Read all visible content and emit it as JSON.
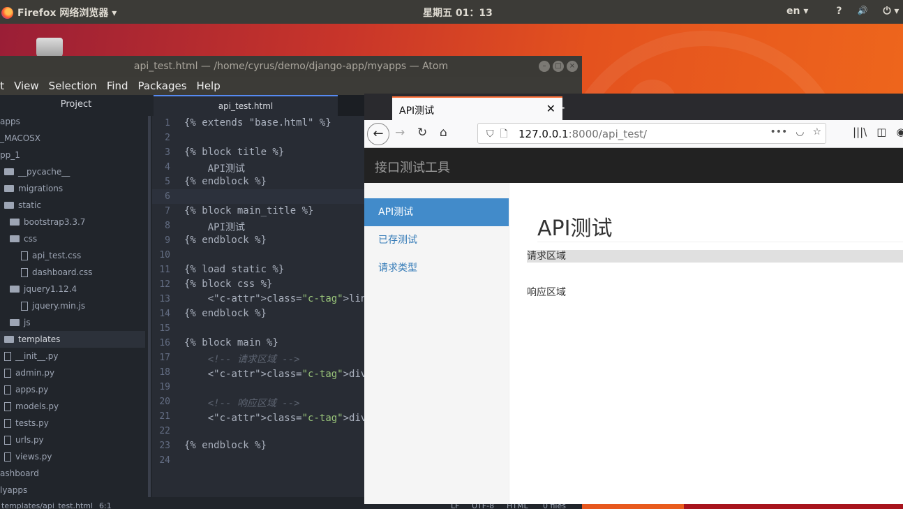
{
  "topbar": {
    "app_menu": "Firefox 网络浏览器 ▾",
    "clock": "星期五 01：13",
    "lang": "en ▾",
    "indicators": [
      "?",
      "🔊",
      "⏻ ▾"
    ]
  },
  "atom": {
    "window_title": "api_test.html — /home/cyrus/demo/django-app/myapps — Atom",
    "menu": [
      "it",
      "View",
      "Selection",
      "Find",
      "Packages",
      "Help"
    ],
    "tree_header": "Project",
    "tab_label": "api_test.html",
    "tree": [
      {
        "label": "apps",
        "kind": "none"
      },
      {
        "label": "_MACOSX",
        "kind": "none"
      },
      {
        "label": "pp_1",
        "kind": "none"
      },
      {
        "label": "__pycache__",
        "kind": "folder"
      },
      {
        "label": "migrations",
        "kind": "folder"
      },
      {
        "label": "static",
        "kind": "folder"
      },
      {
        "label": "bootstrap3.3.7",
        "kind": "folder"
      },
      {
        "label": "css",
        "kind": "folder"
      },
      {
        "label": "api_test.css",
        "kind": "file"
      },
      {
        "label": "dashboard.css",
        "kind": "file"
      },
      {
        "label": "jquery1.12.4",
        "kind": "folder"
      },
      {
        "label": "jquery.min.js",
        "kind": "file"
      },
      {
        "label": "js",
        "kind": "folder"
      },
      {
        "label": "templates",
        "kind": "folder"
      },
      {
        "label": "__init__.py",
        "kind": "file"
      },
      {
        "label": "admin.py",
        "kind": "file"
      },
      {
        "label": "apps.py",
        "kind": "file"
      },
      {
        "label": "models.py",
        "kind": "file"
      },
      {
        "label": "tests.py",
        "kind": "file"
      },
      {
        "label": "urls.py",
        "kind": "file"
      },
      {
        "label": "views.py",
        "kind": "file"
      },
      {
        "label": "ashboard",
        "kind": "none"
      },
      {
        "label": "lyapps",
        "kind": "none"
      }
    ],
    "code_lines": [
      "{% extends \"base.html\" %}",
      "",
      "{% block title %}",
      "    API测试",
      "{% endblock %}",
      "",
      "{% block main_title %}",
      "    API测试",
      "{% endblock %}",
      "",
      "{% load static %}",
      "{% block css %}",
      "    <link href=\"{% static 'css/",
      "{% endblock %}",
      "",
      "{% block main %}",
      "    <!-- 请求区域 -->",
      "    <div class=\"row top\">请求区域",
      "",
      "    <!-- 响应区域 -->",
      "    <div class=\"row bottom\">响应",
      "",
      "{% endblock %}",
      ""
    ],
    "status": {
      "path": "templates/api_test.html",
      "cursor": "6:1",
      "eol": "LF",
      "encoding": "UTF-8",
      "grammar": "HTML",
      "files": "0 files"
    }
  },
  "firefox": {
    "tab_title": "API测试",
    "url_host": "127.0.0.1",
    "url_path": ":8000/api_test/",
    "page": {
      "brand": "接口测试工具",
      "sidebar": [
        "API测试",
        "已存测试",
        "请求类型"
      ],
      "title": "API测试",
      "row_top": "请求区域",
      "row_bottom": "响应区域"
    }
  },
  "colors": {
    "atom_bg": "#282c34",
    "tree_bg": "#21252b",
    "sidebar_active": "#428bca",
    "ubuntu_orange": "#e95420"
  }
}
